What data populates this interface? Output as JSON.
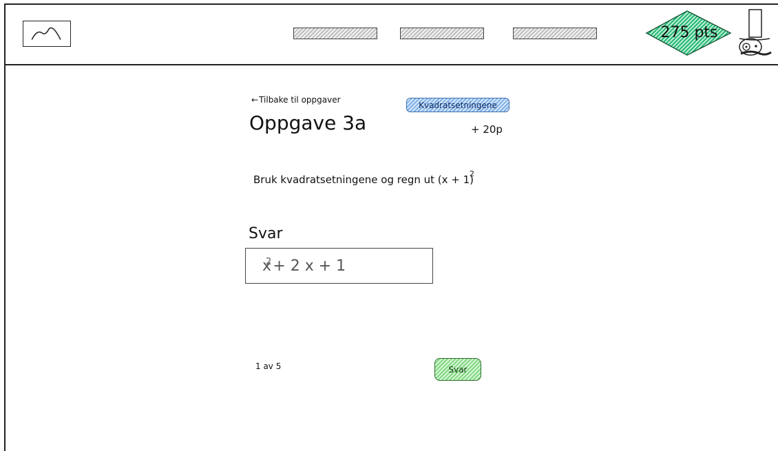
{
  "header": {
    "nav_items": [
      "",
      "",
      ""
    ],
    "points_label": "275 pts"
  },
  "task": {
    "back_link": "Tilbake til oppgaver",
    "title": "Oppgave 3a",
    "topic_tag": "Kvadratsetningene",
    "reward": "+ 20p",
    "question_text": "Bruk kvadratsetningene og regn ut (x + 1)",
    "question_exponent": "2"
  },
  "answer": {
    "label": "Svar",
    "value_base": "x",
    "value_exponent": "2",
    "value_rest": "+ 2 x + 1"
  },
  "footer": {
    "page_count": "1 av 5",
    "submit_label": "Svar"
  },
  "colors": {
    "tag_fill": "#7fb0e6",
    "submit_fill": "#7fd87f",
    "points_fill": "#22b573"
  }
}
